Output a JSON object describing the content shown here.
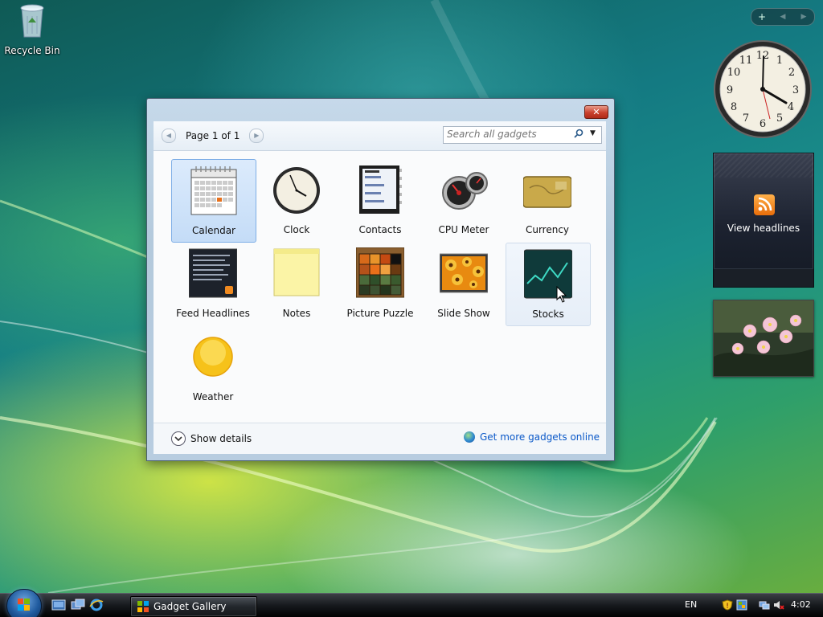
{
  "desktop": {
    "recycle_bin_label": "Recycle Bin"
  },
  "sidebar": {
    "add_label": "+",
    "prev_label": "◀",
    "next_label": "▶",
    "feed_label": "View headlines"
  },
  "window": {
    "title": "Gadget Gallery",
    "close_label": "✕",
    "page_label": "Page 1 of 1",
    "search_placeholder": "Search all gadgets",
    "gadgets": [
      {
        "name": "Calendar"
      },
      {
        "name": "Clock"
      },
      {
        "name": "Contacts"
      },
      {
        "name": "CPU Meter"
      },
      {
        "name": "Currency"
      },
      {
        "name": "Feed Headlines"
      },
      {
        "name": "Notes"
      },
      {
        "name": "Picture Puzzle"
      },
      {
        "name": "Slide Show"
      },
      {
        "name": "Stocks"
      },
      {
        "name": "Weather"
      }
    ],
    "selected": "Calendar",
    "hovered": "Stocks",
    "show_details_label": "Show details",
    "get_more_label": "Get more gadgets online",
    "link_color": "#0a58c8"
  },
  "taskbar": {
    "task_label": "Gadget Gallery",
    "language": "EN",
    "time": "4:02"
  }
}
